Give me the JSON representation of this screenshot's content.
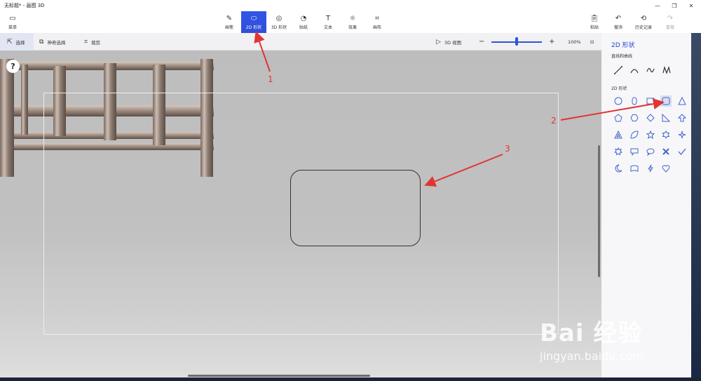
{
  "window": {
    "title": "无标题* - 画图 3D"
  },
  "ribbon": {
    "menu": "菜单",
    "tools": [
      {
        "label": "画笔",
        "icon": "brush-icon"
      },
      {
        "label": "2D 形状",
        "icon": "shapes-2d-icon",
        "active": true
      },
      {
        "label": "3D 形状",
        "icon": "shapes-3d-icon"
      },
      {
        "label": "贴纸",
        "icon": "sticker-icon"
      },
      {
        "label": "文本",
        "icon": "text-icon"
      },
      {
        "label": "效果",
        "icon": "effects-icon"
      },
      {
        "label": "画布",
        "icon": "canvas-icon"
      }
    ],
    "right": [
      {
        "label": "粘贴",
        "icon": "paste-icon"
      },
      {
        "label": "撤消",
        "icon": "undo-icon"
      },
      {
        "label": "历史记录",
        "icon": "history-icon"
      },
      {
        "label": "重做",
        "icon": "redo-icon",
        "disabled": true
      }
    ]
  },
  "toolbar": {
    "select": "选择",
    "magic_select": "神奇选择",
    "crop": "裁剪",
    "view_3d": "3D 视图",
    "zoom": "100%"
  },
  "panel": {
    "title": "2D 形状",
    "lines_section": "直线和曲线",
    "shapes_section": "2D 形状"
  },
  "annotations": [
    "1",
    "2",
    "3"
  ],
  "watermark": {
    "brand": "Bai 经验",
    "url": "jingyan.baidu.com"
  },
  "help": "?",
  "colors": {
    "accent": "#2f55d4",
    "annotation": "#e23434"
  }
}
